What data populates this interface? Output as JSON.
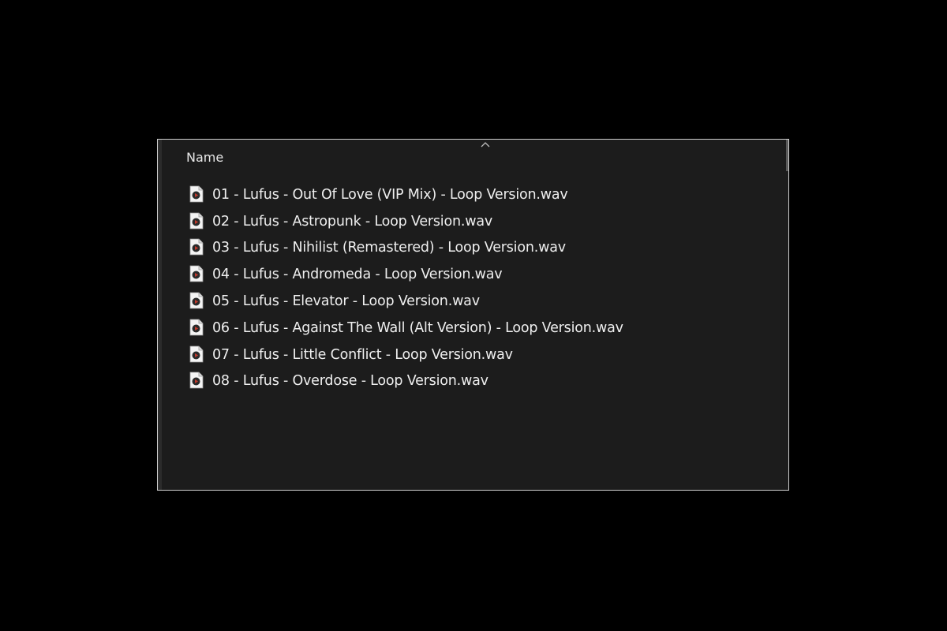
{
  "column": {
    "name_label": "Name",
    "sort_icon": "chevron-up-icon"
  },
  "files": [
    {
      "name": "01 - Lufus - Out Of Love (VIP Mix) - Loop Version.wav",
      "icon": "wav-file-icon"
    },
    {
      "name": "02 - Lufus - Astropunk - Loop Version.wav",
      "icon": "wav-file-icon"
    },
    {
      "name": "03 - Lufus - Nihilist (Remastered) - Loop Version.wav",
      "icon": "wav-file-icon"
    },
    {
      "name": "04 - Lufus - Andromeda - Loop Version.wav",
      "icon": "wav-file-icon"
    },
    {
      "name": "05 - Lufus - Elevator - Loop Version.wav",
      "icon": "wav-file-icon"
    },
    {
      "name": "06 - Lufus - Against The Wall (Alt Version) - Loop Version.wav",
      "icon": "wav-file-icon"
    },
    {
      "name": "07 - Lufus - Little Conflict - Loop Version.wav",
      "icon": "wav-file-icon"
    },
    {
      "name": "08 - Lufus - Overdose - Loop Version.wav",
      "icon": "wav-file-icon"
    }
  ],
  "colors": {
    "background": "#000000",
    "pane": "#1c1c1c",
    "text": "#efefef",
    "icon_accent": "#c0392b"
  }
}
